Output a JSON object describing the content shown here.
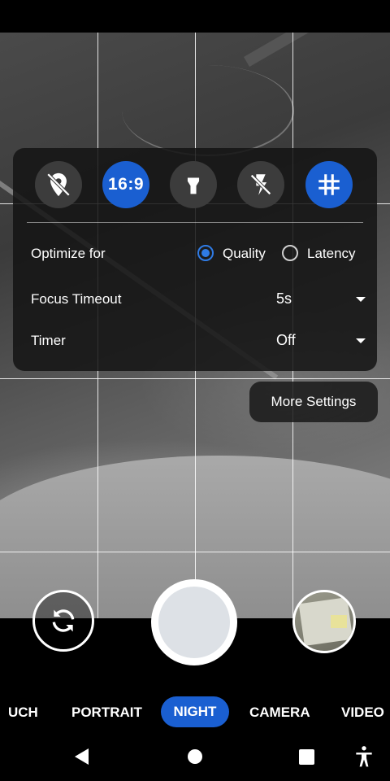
{
  "quick_settings": {
    "location_icon": "location-off-icon",
    "aspect_ratio_label": "16:9",
    "flashlight_icon": "flashlight-icon",
    "flash_icon": "flash-off-icon",
    "grid_icon": "grid-icon"
  },
  "settings": {
    "optimize_label": "Optimize for",
    "optimize_options": [
      "Quality",
      "Latency"
    ],
    "optimize_selected": "Quality",
    "focus_timeout_label": "Focus Timeout",
    "focus_timeout_value": "5s",
    "timer_label": "Timer",
    "timer_value": "Off"
  },
  "more_settings_label": "More Settings",
  "controls": {
    "switch_camera_icon": "switch-camera-icon",
    "thumbnail": "last-photo-thumbnail"
  },
  "modes": {
    "items": [
      "UCH",
      "PORTRAIT",
      "NIGHT",
      "CAMERA",
      "VIDEO"
    ],
    "active": "NIGHT"
  },
  "colors": {
    "accent": "#1a5fd1",
    "panel": "#141414",
    "radio_on": "#2f7be5"
  }
}
